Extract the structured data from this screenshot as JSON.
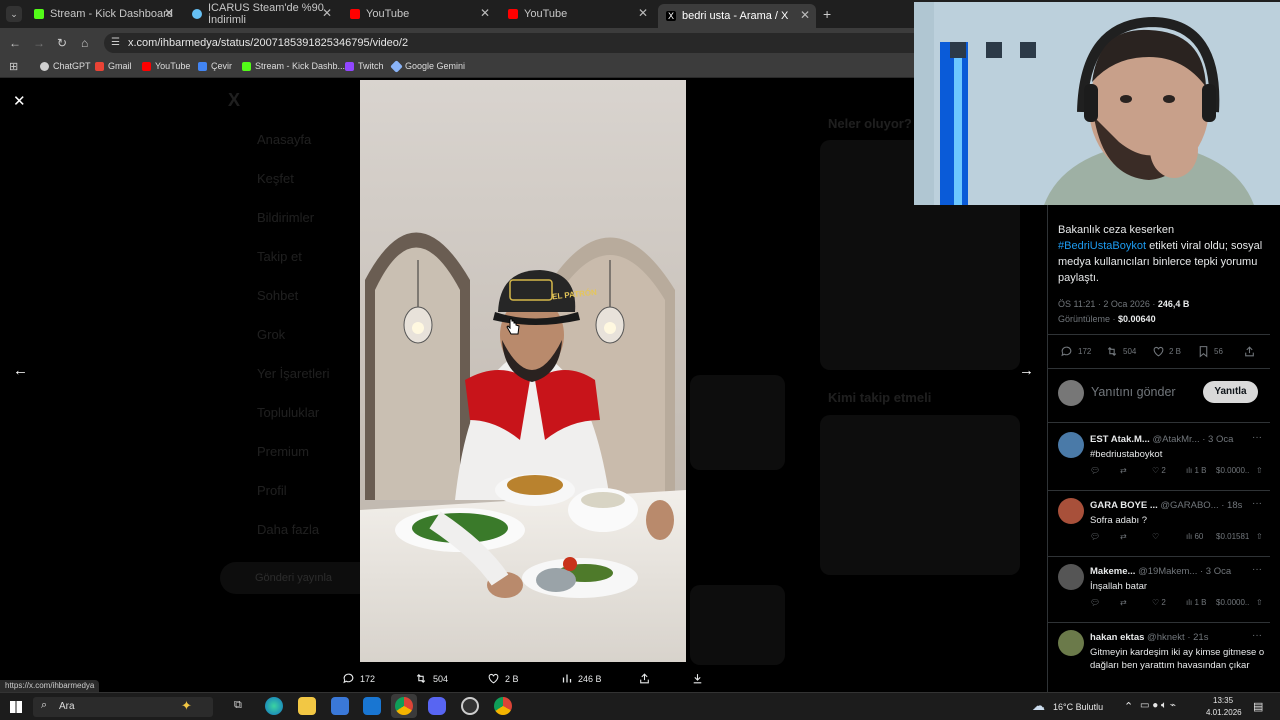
{
  "browser": {
    "tabs": [
      {
        "label": "Stream - Kick Dashboard",
        "color": "#53fc18"
      },
      {
        "label": "ICARUS Steam'de %90 İndirimli",
        "color": "#66c0f4"
      },
      {
        "label": "YouTube",
        "color": "#ff0000"
      },
      {
        "label": "YouTube",
        "color": "#ff0000"
      },
      {
        "label": "bedri usta - Arama / X",
        "color": "#ffffff"
      }
    ],
    "url": "x.com/ihbarmedya/status/2007185391825346795/video/2",
    "bookmarks": [
      {
        "label": "ChatGPT",
        "color": "#cfcfcf"
      },
      {
        "label": "Gmail",
        "color": "#ea4335"
      },
      {
        "label": "YouTube",
        "color": "#ff0000"
      },
      {
        "label": "Çevir",
        "color": "#4285f4"
      },
      {
        "label": "Stream - Kick Dashb...",
        "color": "#53fc18"
      },
      {
        "label": "Twitch",
        "color": "#9146ff"
      },
      {
        "label": "Google Gemini",
        "color": "#8ab4f8"
      }
    ],
    "status_url": "https://x.com/ihbarmedya"
  },
  "background_page": {
    "nav": [
      "Anasayfa",
      "Keşfet",
      "Bildirimler",
      "Takip et",
      "Sohbet",
      "Grok",
      "Yer İşaretleri",
      "Topluluklar",
      "Premium",
      "Profil",
      "Daha fazla"
    ],
    "post_button": "Gönderi yayınla",
    "trends_title": "Neler oluyor?",
    "who_to_follow": "Kimi takip etmeli"
  },
  "video": {
    "cap_text": "EL PATRÓN",
    "stats": {
      "replies": "172",
      "reposts": "504",
      "likes": "2 B",
      "views": "246 B"
    }
  },
  "tweet": {
    "text_before": "Bakanlık ceza keserken ",
    "hashtag": "#BedriUstaBoykot",
    "text_after": " etiketi viral oldu; sosyal medya kullanıcıları binlerce tepki yorumu paylaştı.",
    "time": "ÖS 11:21 · 2 Oca 2026 · ",
    "views_count": "246,4 B",
    "views_label": "Görüntüleme · ",
    "price": "$0.00640",
    "stats": {
      "replies": "172",
      "reposts": "504",
      "likes": "2 B",
      "bookmarks": "56"
    },
    "reply_placeholder": "Yanıtını gönder",
    "reply_button": "Yanıtla"
  },
  "replies": [
    {
      "name": "EST Atak.M...",
      "handle": "@AtakMr... · 3 Oca",
      "text": "#bedriustaboykot",
      "is_link": true,
      "likes": "2",
      "views": "1 B",
      "price": "$0.0000..",
      "avatar_color": "#4a7aa8"
    },
    {
      "name": "GARA BOYE ...",
      "handle": "@GARABO... · 18s",
      "text": "Sofra adabı ?",
      "is_link": false,
      "likes": "",
      "views": "60",
      "price": "$0.01581",
      "avatar_color": "#a8503a"
    },
    {
      "name": "Makeme...",
      "handle": "@19Makem... · 3 Oca",
      "text": "İnşallah batar",
      "is_link": false,
      "likes": "2",
      "views": "1 B",
      "price": "$0.0000..",
      "avatar_color": "#555555"
    },
    {
      "name": "hakan ektas",
      "handle": "@hknekt · 21s",
      "text": "Gitmeyin kardeşim iki ay kimse gitmese o dağları ben yarattım havasından çıkar",
      "is_link": false,
      "likes": "",
      "views": "",
      "price": "",
      "avatar_color": "#6b7a4a"
    }
  ],
  "taskbar": {
    "search": "Ara",
    "weather": "16°C Bulutlu",
    "time": "13:35",
    "date": "4.01.2026"
  }
}
